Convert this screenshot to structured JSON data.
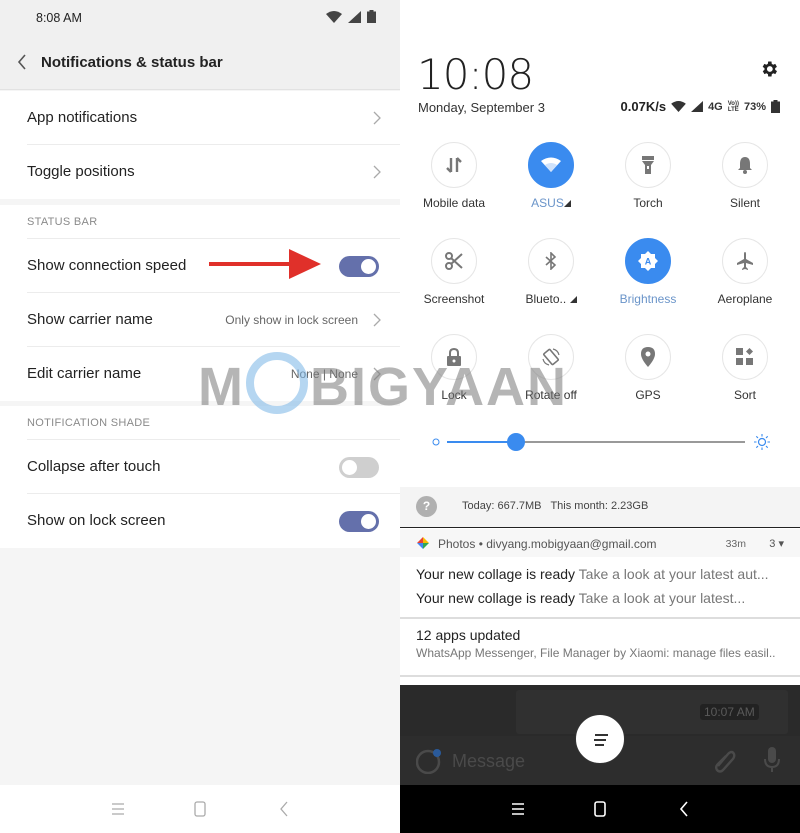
{
  "left": {
    "status_bar": {
      "time": "8:08 AM"
    },
    "app_bar": {
      "title": "Notifications & status bar"
    },
    "top_items": [
      {
        "label": "App notifications"
      },
      {
        "label": "Toggle positions"
      }
    ],
    "status_bar_section": {
      "header": "STATUS BAR",
      "items": [
        {
          "label": "Show connection speed",
          "type": "toggle",
          "on": true
        },
        {
          "label": "Show carrier name",
          "type": "link",
          "value": "Only show in lock screen"
        },
        {
          "label": "Edit carrier name",
          "type": "link",
          "value": "None | None"
        }
      ]
    },
    "notification_shade_section": {
      "header": "NOTIFICATION SHADE",
      "items": [
        {
          "label": "Collapse after touch",
          "type": "toggle",
          "on": false
        },
        {
          "label": "Show on lock screen",
          "type": "toggle",
          "on": true
        }
      ]
    },
    "nav": [
      "menu-icon",
      "home-icon",
      "back-icon"
    ]
  },
  "right": {
    "clock": "10:08",
    "date": "Monday, September 3",
    "status": {
      "speed": "0.07K/s",
      "network": "4G",
      "volte_top": "Vo))",
      "volte_bottom": "LTE",
      "battery": "73%"
    },
    "tiles": [
      {
        "label": "Mobile data",
        "icon": "mobile-data-icon",
        "active": false
      },
      {
        "label": "ASUS",
        "icon": "wifi-icon",
        "active": true,
        "expandable": true
      },
      {
        "label": "Torch",
        "icon": "torch-icon",
        "active": false
      },
      {
        "label": "Silent",
        "icon": "bell-icon",
        "active": false
      },
      {
        "label": "Screenshot",
        "icon": "scissors-icon",
        "active": false
      },
      {
        "label": "Blueto..",
        "icon": "bluetooth-icon",
        "active": false,
        "expandable": true
      },
      {
        "label": "Brightness",
        "icon": "auto-brightness-icon",
        "active": true
      },
      {
        "label": "Aeroplane",
        "icon": "airplane-icon",
        "active": false
      },
      {
        "label": "Lock",
        "icon": "lock-icon",
        "active": false
      },
      {
        "label": "Rotate off",
        "icon": "rotate-icon",
        "active": false
      },
      {
        "label": "GPS",
        "icon": "location-icon",
        "active": false
      },
      {
        "label": "Sort",
        "icon": "sort-icon",
        "active": false
      }
    ],
    "brightness": 0.23,
    "data_usage": {
      "question": "?",
      "text": "Today: 667.7MB   This month: 2.23GB"
    },
    "notifications": [
      {
        "app": "Photos • divyang.mobigyaan@gmail.com",
        "age": "33m",
        "count": "3 ▾",
        "lines": [
          {
            "title": "Your new collage is ready",
            "body": "Take a look at your latest aut..."
          },
          {
            "title": "Your new collage is ready",
            "body": "Take a look at your latest..."
          }
        ]
      },
      {
        "title": "12 apps updated",
        "body": "WhatsApp Messenger, File Manager by Xiaomi: manage files easil.."
      }
    ],
    "background_app": {
      "timestamp": "10:07 AM",
      "message_placeholder": "Message"
    }
  },
  "watermark": {
    "left": "M",
    "right": "BIGYAAN"
  },
  "colors": {
    "accent_blue": "#3a8bef",
    "toggle_on": "#6470ab",
    "toggle_off": "#cfcfcf",
    "arrow_red": "#e0302a"
  }
}
